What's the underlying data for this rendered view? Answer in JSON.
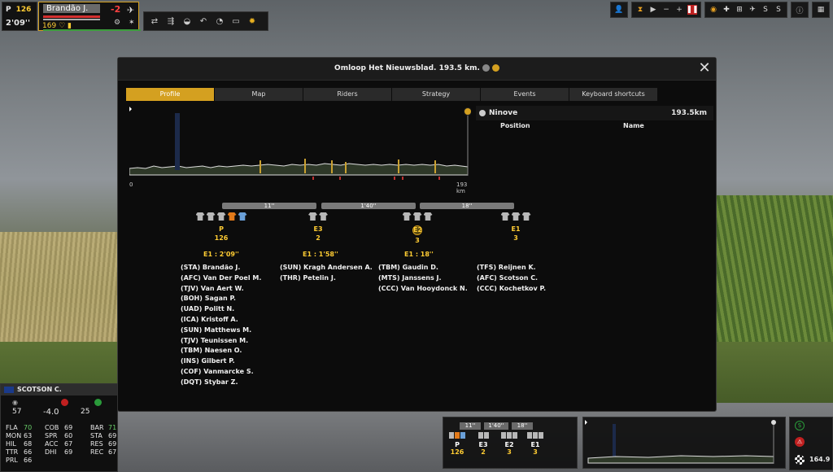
{
  "hud": {
    "position_label": "P",
    "position_number": "126",
    "time_gap": "2'09''",
    "rider_name": "Brandão J.",
    "delta": "-2",
    "energy": "169"
  },
  "dialog": {
    "title": "Omloop Het Nieuwsblad. 193.5 km.",
    "tabs": [
      "Profile",
      "Map",
      "Riders",
      "Strategy",
      "Events",
      "Keyboard shortcuts"
    ],
    "active_tab": "Profile",
    "profile_start": "0",
    "profile_end": "193 km",
    "location": "Ninove",
    "location_distance": "193.5km",
    "col_position": "Position",
    "col_name": "Name"
  },
  "gap_bars": [
    "11''",
    "1'40''",
    "18''"
  ],
  "groups": [
    {
      "name": "P",
      "count": "126",
      "gap": "E1 : 2'09''",
      "riders": [
        "(STA) Brandão J.",
        "(AFC) Van Der Poel M.",
        "(TJV) Van Aert W.",
        "(BOH) Sagan P.",
        "(UAD) Politt N.",
        "(ICA) Kristoff A.",
        "(SUN) Matthews M.",
        "(TJV) Teunissen M.",
        "(TBM) Naesen O.",
        "(INS) Gilbert P.",
        "(COF) Vanmarcke S.",
        "(DQT) Stybar Z."
      ]
    },
    {
      "name": "E3",
      "count": "2",
      "gap": "E1 : 1'58''",
      "riders": [
        "(SUN) Kragh Andersen A.",
        "(THR) Petelin J."
      ]
    },
    {
      "name": "E2",
      "count": "3",
      "gap": "E1 : 18''",
      "riders": [
        "(TBM) Gaudin D.",
        "(MTS) Janssens J.",
        "(CCC) Van Hooydonck N."
      ]
    },
    {
      "name": "E1",
      "count": "3",
      "gap": "",
      "riders": [
        "(TFS) Reijnen K.",
        "(AFC) Scotson C.",
        "(CCC) Kochetkov P."
      ]
    }
  ],
  "rider_card": {
    "name": "SCOTSON C.",
    "speed": "57",
    "slope": "-4.0",
    "cadence": "25",
    "stats": [
      [
        "FLA",
        "70",
        "COB",
        "69",
        "BAR",
        "71"
      ],
      [
        "MON",
        "63",
        "SPR",
        "60",
        "STA",
        "69"
      ],
      [
        "HIL",
        "68",
        "ACC",
        "67",
        "RES",
        "69"
      ],
      [
        "TTR",
        "66",
        "DHI",
        "69",
        "REC",
        "67"
      ],
      [
        "PRL",
        "66",
        "",
        "",
        "",
        ""
      ]
    ]
  },
  "mini_overview": {
    "gaps": [
      "11''",
      "1'40''",
      "18''"
    ],
    "groups": [
      {
        "label": "P",
        "count": "126"
      },
      {
        "label": "E3",
        "count": "2"
      },
      {
        "label": "E2",
        "count": "3"
      },
      {
        "label": "E1",
        "count": "3"
      }
    ]
  },
  "status": {
    "remaining": "164.9"
  },
  "colors": {
    "accent": "#d4a020",
    "highlight_text": "#ffcc33",
    "alert": "#c02020",
    "ok": "#2a9a3a"
  },
  "icons": {
    "toolbar": [
      "gear-icon",
      "attack-icon",
      "follow-icon",
      "rider-icon",
      "u-turn-icon",
      "wheel-icon",
      "sun-icon"
    ],
    "topright": [
      "profile-icon",
      "hourglass-icon",
      "play-icon",
      "minus-icon",
      "plus-icon",
      "pause-icon",
      "eye-icon",
      "helicopter-icon",
      "car-icon",
      "plane-icon",
      "s-icon",
      "s-icon",
      "info-icon",
      "settings-icon"
    ]
  }
}
